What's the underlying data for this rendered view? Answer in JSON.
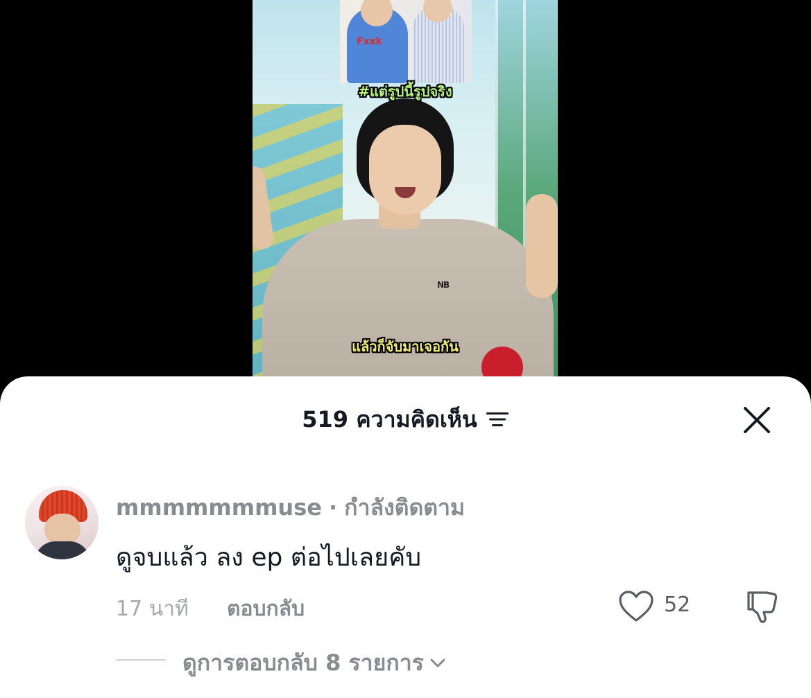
{
  "video": {
    "caption_top": "#แต่รูปนี้รูปจริง",
    "caption_bottom": "แล้วก็จับมาเจอกัน",
    "poster_text": "Fxxk"
  },
  "comments_panel": {
    "title": "519 ความคิดเห็น",
    "filter_icon": "sort-lines-icon",
    "close_icon": "close-x-icon"
  },
  "comment": {
    "username": "mmmmmmmuse",
    "separator": "·",
    "follow_status": "กำลังติดตาม",
    "text": "ดูจบแล้ว ลง ep ต่อไปเลยคับ",
    "time": "17 นาที",
    "reply_label": "ตอบกลับ",
    "like_count": "52",
    "view_replies_label": "ดูการตอบกลับ 8 รายการ"
  },
  "colors": {
    "text_primary": "#161823",
    "text_secondary": "#8a8b91",
    "caption_top": "#b6f57a",
    "caption_bottom": "#f3ef73"
  }
}
